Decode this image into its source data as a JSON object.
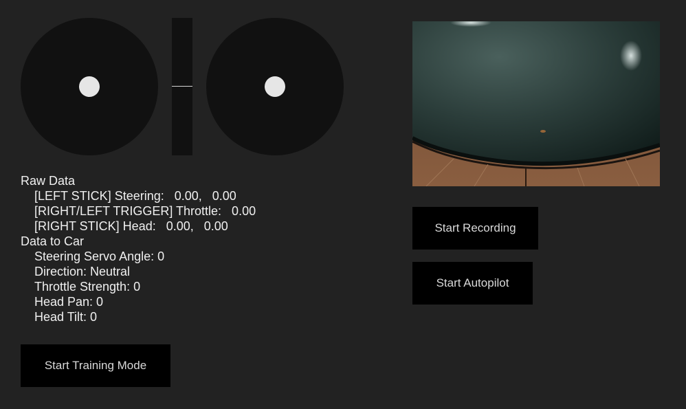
{
  "raw_data": {
    "heading": "Raw Data",
    "left_stick_line": "[LEFT STICK] Steering:   0.00,   0.00",
    "trigger_line": "[RIGHT/LEFT TRIGGER] Throttle:   0.00",
    "right_stick_line": "[RIGHT STICK] Head:   0.00,   0.00"
  },
  "car_data": {
    "heading": "Data to Car",
    "steering_servo": "Steering Servo Angle: 0",
    "direction": "Direction: Neutral",
    "throttle_strength": "Throttle Strength: 0",
    "head_pan": "Head Pan: 0",
    "head_tilt": "Head Tilt: 0"
  },
  "buttons": {
    "training": "Start Training Mode",
    "recording": "Start Recording",
    "autopilot": "Start Autopilot"
  },
  "controller": {
    "left_stick_x": 0.0,
    "left_stick_y": 0.0,
    "throttle": 0.0,
    "right_stick_x": 0.0,
    "right_stick_y": 0.0
  },
  "colors": {
    "background": "#222222",
    "pad": "#111111",
    "knob": "#e6e6e6",
    "button": "#000000",
    "button_text": "#d9d9d9",
    "text": "#f0f0f0"
  }
}
